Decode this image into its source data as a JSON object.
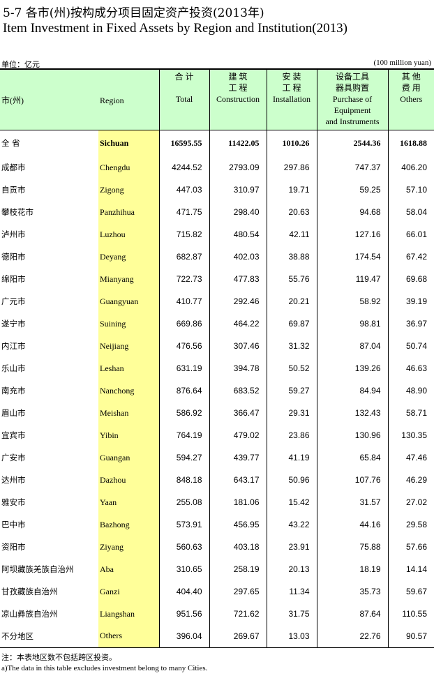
{
  "title_cn": "5-7  各市(州)按构成分项目固定资产投资(2013年)",
  "title_en": "Item Investment in Fixed Assets by Region and Institution(2013)",
  "unit_cn": "单位：亿元",
  "unit_en": "(100 million yuan)",
  "headers": {
    "city_cn": "市(州)",
    "region": "Region",
    "total_cn": "合   计",
    "total_en": "Total",
    "construction_cn_1": "建  筑",
    "construction_cn_2": "工  程",
    "construction_en": "Construction",
    "installation_cn_1": "安  装",
    "installation_cn_2": "工  程",
    "installation_en": "Installation",
    "equipment_cn_1": "设备工具",
    "equipment_cn_2": "器具购置",
    "equipment_en_1": "Purchase of",
    "equipment_en_2": "Equipment",
    "equipment_en_3": "and Instruments",
    "others_cn_1": "其  他",
    "others_cn_2": "费  用",
    "others_en": "Others"
  },
  "rows": [
    {
      "cn": "全    省",
      "en": "Sichuan",
      "total": "16595.55",
      "construction": "11422.05",
      "installation": "1010.26",
      "equipment": "2544.36",
      "others": "1618.88"
    },
    {
      "cn": "成都市",
      "en": "Chengdu",
      "total": "4244.52",
      "construction": "2793.09",
      "installation": "297.86",
      "equipment": "747.37",
      "others": "406.20"
    },
    {
      "cn": "自贡市",
      "en": "Zigong",
      "total": "447.03",
      "construction": "310.97",
      "installation": "19.71",
      "equipment": "59.25",
      "others": "57.10"
    },
    {
      "cn": "攀枝花市",
      "en": "Panzhihua",
      "total": "471.75",
      "construction": "298.40",
      "installation": "20.63",
      "equipment": "94.68",
      "others": "58.04"
    },
    {
      "cn": "泸州市",
      "en": "Luzhou",
      "total": "715.82",
      "construction": "480.54",
      "installation": "42.11",
      "equipment": "127.16",
      "others": "66.01"
    },
    {
      "cn": "德阳市",
      "en": "Deyang",
      "total": "682.87",
      "construction": "402.03",
      "installation": "38.88",
      "equipment": "174.54",
      "others": "67.42"
    },
    {
      "cn": "绵阳市",
      "en": "Mianyang",
      "total": "722.73",
      "construction": "477.83",
      "installation": "55.76",
      "equipment": "119.47",
      "others": "69.68"
    },
    {
      "cn": "广元市",
      "en": "Guangyuan",
      "total": "410.77",
      "construction": "292.46",
      "installation": "20.21",
      "equipment": "58.92",
      "others": "39.19"
    },
    {
      "cn": "遂宁市",
      "en": "Suining",
      "total": "669.86",
      "construction": "464.22",
      "installation": "69.87",
      "equipment": "98.81",
      "others": "36.97"
    },
    {
      "cn": "内江市",
      "en": "Neijiang",
      "total": "476.56",
      "construction": "307.46",
      "installation": "31.32",
      "equipment": "87.04",
      "others": "50.74"
    },
    {
      "cn": "乐山市",
      "en": "Leshan",
      "total": "631.19",
      "construction": "394.78",
      "installation": "50.52",
      "equipment": "139.26",
      "others": "46.63"
    },
    {
      "cn": "南充市",
      "en": "Nanchong",
      "total": "876.64",
      "construction": "683.52",
      "installation": "59.27",
      "equipment": "84.94",
      "others": "48.90"
    },
    {
      "cn": "眉山市",
      "en": "Meishan",
      "total": "586.92",
      "construction": "366.47",
      "installation": "29.31",
      "equipment": "132.43",
      "others": "58.71"
    },
    {
      "cn": "宜宾市",
      "en": "Yibin",
      "total": "764.19",
      "construction": "479.02",
      "installation": "23.86",
      "equipment": "130.96",
      "others": "130.35"
    },
    {
      "cn": "广安市",
      "en": "Guangan",
      "total": "594.27",
      "construction": "439.77",
      "installation": "41.19",
      "equipment": "65.84",
      "others": "47.46"
    },
    {
      "cn": "达州市",
      "en": "Dazhou",
      "total": "848.18",
      "construction": "643.17",
      "installation": "50.96",
      "equipment": "107.76",
      "others": "46.29"
    },
    {
      "cn": "雅安市",
      "en": "Yaan",
      "total": "255.08",
      "construction": "181.06",
      "installation": "15.42",
      "equipment": "31.57",
      "others": "27.02"
    },
    {
      "cn": "巴中市",
      "en": "Bazhong",
      "total": "573.91",
      "construction": "456.95",
      "installation": "43.22",
      "equipment": "44.16",
      "others": "29.58"
    },
    {
      "cn": "资阳市",
      "en": "Ziyang",
      "total": "560.63",
      "construction": "403.18",
      "installation": "23.91",
      "equipment": "75.88",
      "others": "57.66"
    },
    {
      "cn": "阿坝藏族羌族自治州",
      "en": "Aba",
      "total": "310.65",
      "construction": "258.19",
      "installation": "20.13",
      "equipment": "18.19",
      "others": "14.14"
    },
    {
      "cn": "甘孜藏族自治州",
      "en": "Ganzi",
      "total": "404.40",
      "construction": "297.65",
      "installation": "11.34",
      "equipment": "35.73",
      "others": "59.67"
    },
    {
      "cn": "凉山彝族自治州",
      "en": "Liangshan",
      "total": "951.56",
      "construction": "721.62",
      "installation": "31.75",
      "equipment": "87.64",
      "others": "110.55"
    },
    {
      "cn": "不分地区",
      "en": "Others",
      "total": "396.04",
      "construction": "269.67",
      "installation": "13.03",
      "equipment": "22.76",
      "others": "90.57"
    }
  ],
  "note_cn": "注：本表地区数不包括跨区投资。",
  "note_en": "a)The data in this table excludes  investment belong to many Cities."
}
